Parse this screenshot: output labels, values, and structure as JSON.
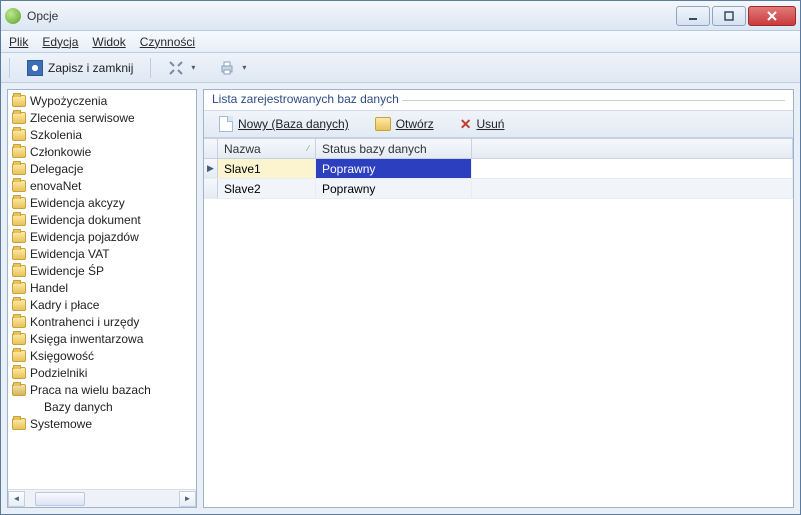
{
  "window": {
    "title": "Opcje"
  },
  "menu": {
    "file": "Plik",
    "edit": "Edycja",
    "view": "Widok",
    "actions": "Czynności"
  },
  "toolbar": {
    "save_close": "Zapisz i zamknij"
  },
  "tree": {
    "items": [
      "Wypożyczenia",
      "Zlecenia serwisowe",
      "Szkolenia",
      "Członkowie",
      "Delegacje",
      "enovaNet",
      "Ewidencja akcyzy",
      "Ewidencja dokument",
      "Ewidencja pojazdów",
      "Ewidencja VAT",
      "Ewidencje ŚP",
      "Handel",
      "Kadry i płace",
      "Kontrahenci i urzędy",
      "Księga inwentarzowa",
      "Księgowość",
      "Podzielniki",
      "Praca na wielu bazach",
      "Systemowe"
    ],
    "expanded_index": 17,
    "child_of_expanded": "Bazy danych"
  },
  "panel": {
    "title": "Lista zarejestrowanych baz danych",
    "btn_new": "Nowy (Baza danych)",
    "btn_open": "Otwórz",
    "btn_delete": "Usuń",
    "col_name": "Nazwa",
    "col_status": "Status bazy danych",
    "rows": [
      {
        "name": "Slave1",
        "status": "Poprawny",
        "selected": true
      },
      {
        "name": "Slave2",
        "status": "Poprawny",
        "selected": false
      }
    ]
  }
}
